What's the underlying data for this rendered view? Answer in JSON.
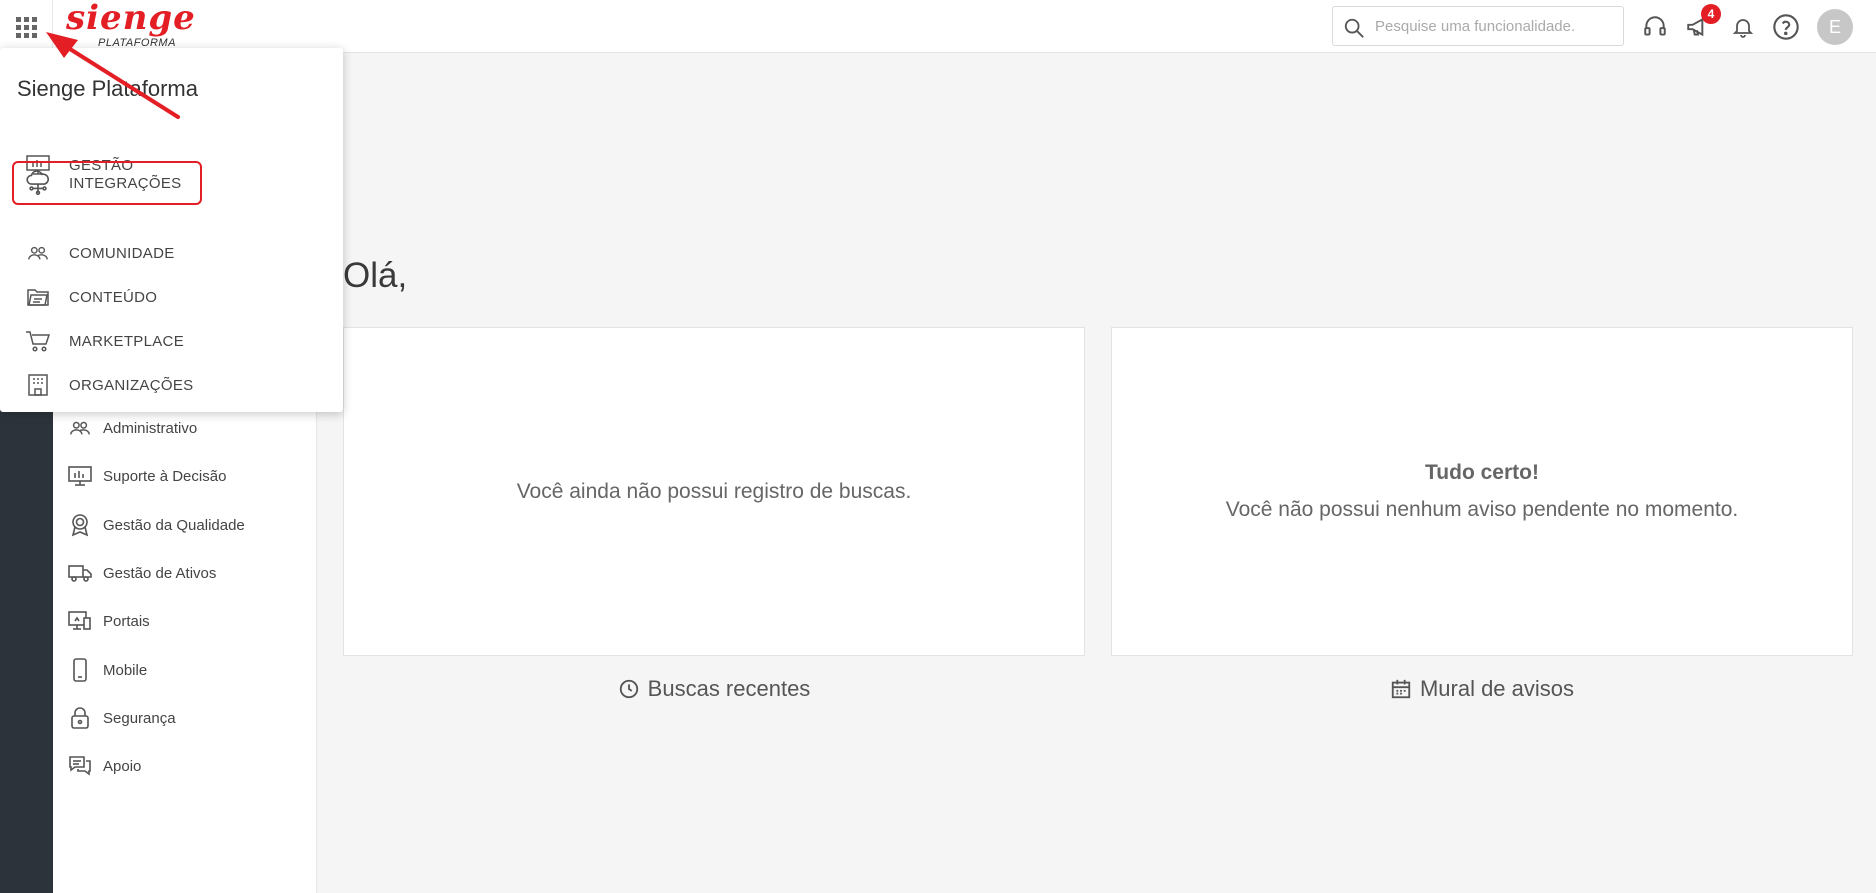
{
  "header": {
    "logo_main": "sienge",
    "logo_sub": "PLATAFORMA",
    "search_placeholder": "Pesquise uma funcionalidade.",
    "notification_count": "4",
    "user_initial": "E"
  },
  "app_menu": {
    "title": "Sienge Plataforma",
    "items": [
      {
        "label": "GESTÃO",
        "icon": "monitor-chart-icon"
      },
      {
        "label": "INTEGRAÇÕES",
        "icon": "cloud-network-icon"
      },
      {
        "label": "COMUNIDADE",
        "icon": "users-icon"
      },
      {
        "label": "CONTEÚDO",
        "icon": "folder-icon"
      },
      {
        "label": "MARKETPLACE",
        "icon": "cart-icon"
      },
      {
        "label": "ORGANIZAÇÕES",
        "icon": "building-icon"
      }
    ]
  },
  "sidebar": {
    "items": [
      {
        "label": "Administrativo",
        "icon": "users-icon"
      },
      {
        "label": "Suporte à Decisão",
        "icon": "monitor-chart-icon"
      },
      {
        "label": "Gestão da Qualidade",
        "icon": "award-icon"
      },
      {
        "label": "Gestão de Ativos",
        "icon": "truck-icon"
      },
      {
        "label": "Portais",
        "icon": "portal-icon"
      },
      {
        "label": "Mobile",
        "icon": "mobile-icon"
      },
      {
        "label": "Segurança",
        "icon": "lock-icon"
      },
      {
        "label": "Apoio",
        "icon": "chat-icon"
      }
    ]
  },
  "main": {
    "greeting": "Olá,",
    "recent_searches": {
      "empty_text": "Você ainda não possui registro de buscas.",
      "footer_label": "Buscas recentes"
    },
    "notices": {
      "title": "Tudo certo!",
      "text": "Você não possui nenhum aviso pendente no momento.",
      "footer_label": "Mural de avisos"
    }
  },
  "colors": {
    "brand_red": "#e31e24",
    "rail_dark": "#2d333b",
    "icon_gray": "#555555"
  }
}
